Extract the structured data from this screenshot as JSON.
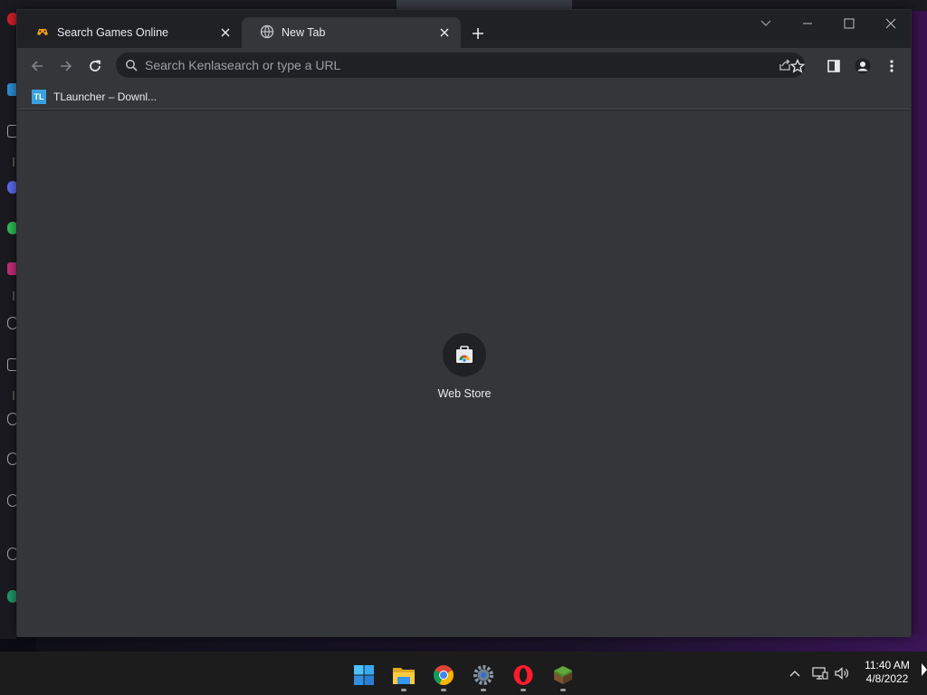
{
  "browser": {
    "tabs": [
      {
        "title": "Search Games Online",
        "icon": "gamepad-icon",
        "active": false
      },
      {
        "title": "New Tab",
        "icon": "globe-icon",
        "active": true
      }
    ],
    "omnibox": {
      "placeholder": "Search Kenlasearch or type a URL",
      "value": ""
    },
    "bookmarks": [
      {
        "label": "TLauncher – Downl...",
        "icon_text": "TL"
      }
    ],
    "new_tab_page": {
      "shortcuts": [
        {
          "label": "Web Store",
          "icon": "web-store-icon"
        }
      ]
    }
  },
  "taskbar": {
    "apps": [
      {
        "name": "start",
        "icon": "windows-start-icon"
      },
      {
        "name": "file-explorer",
        "icon": "folder-icon",
        "running": true
      },
      {
        "name": "chrome",
        "icon": "chrome-icon",
        "running": true
      },
      {
        "name": "settings",
        "icon": "settings-gear-icon",
        "running": true
      },
      {
        "name": "opera",
        "icon": "opera-icon",
        "running": true
      },
      {
        "name": "minecraft",
        "icon": "minecraft-icon",
        "running": true
      }
    ],
    "clock": {
      "time": "11:40 AM",
      "date": "4/8/2022"
    }
  },
  "colors": {
    "tabstrip": "#202124",
    "toolbar": "#35363a",
    "omnibox": "#202124",
    "text": "#e8eaed",
    "taskbar": "#1c1c1c",
    "accent_windows": "#4cc2ff",
    "opera_red": "#ff1b2d",
    "tlauncher_blue": "#3aa0e0"
  }
}
